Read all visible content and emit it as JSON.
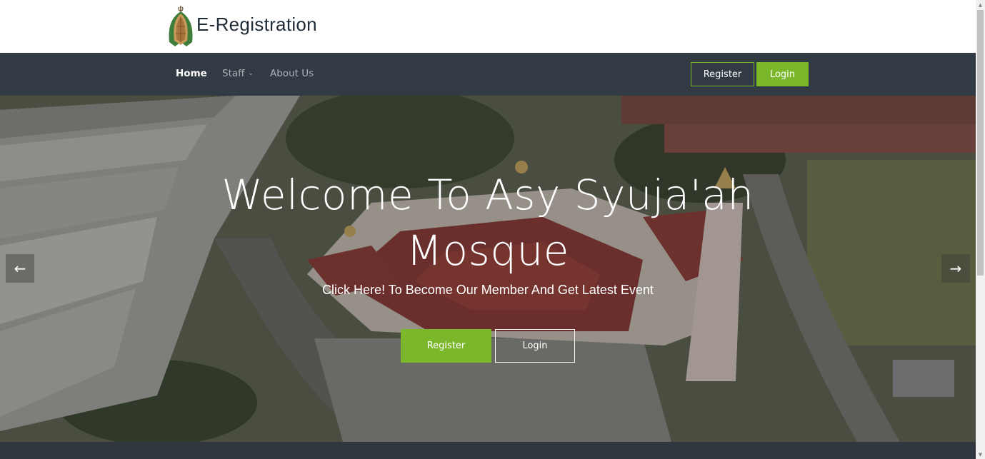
{
  "brand": {
    "title": "E-Registration",
    "logo_icon": "mosque-dome-logo-icon"
  },
  "nav": {
    "items": [
      {
        "label": "Home",
        "active": true
      },
      {
        "label": "Staff",
        "has_dropdown": true
      },
      {
        "label": "About Us"
      }
    ],
    "register_label": "Register",
    "login_label": "Login"
  },
  "hero": {
    "title": "Welcome To Asy Syuja'ah Mosque",
    "subtitle": "Click Here! To Become Our Member And Get Latest Event",
    "register_label": "Register",
    "login_label": "Login",
    "prev_icon": "arrow-left-icon",
    "next_icon": "arrow-right-icon"
  },
  "colors": {
    "accent": "#7ab72a",
    "navbar": "#323a43",
    "brand_text": "#1f2b36"
  }
}
